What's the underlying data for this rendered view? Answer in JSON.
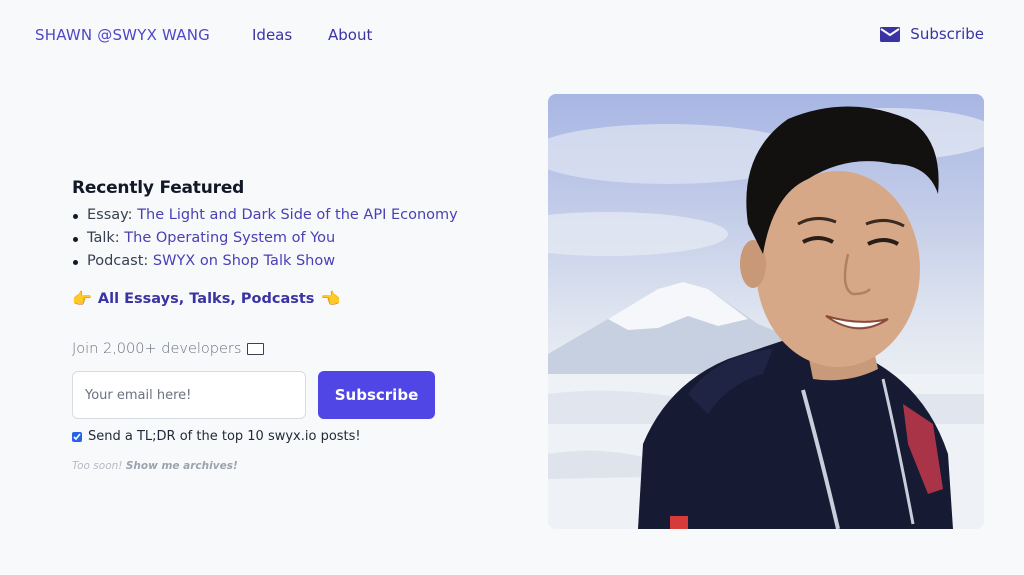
{
  "header": {
    "brand": "SHAWN @SWYX WANG",
    "nav": [
      {
        "label": "Ideas"
      },
      {
        "label": "About"
      }
    ],
    "subscribe": {
      "label": "Subscribe",
      "icon": "mail-icon"
    }
  },
  "featured": {
    "title": "Recently Featured",
    "items": [
      {
        "prefix": "Essay:",
        "link": "The Light and Dark Side of the API Economy"
      },
      {
        "prefix": "Talk:",
        "link": "The Operating System of You"
      },
      {
        "prefix": "Podcast:",
        "link": "SWYX on Shop Talk Show"
      }
    ],
    "all_link": {
      "label": "All Essays, Talks, Podcasts",
      "left_icon": "👉",
      "right_icon": "👈"
    }
  },
  "newsletter": {
    "join_text": "Join 2,000+ developers",
    "join_icon": "envelope-icon",
    "email_placeholder": "Your email here!",
    "email_value": "",
    "button_label": "Subscribe",
    "checkbox_label": "Send a TL;DR of the top 10 swyx.io posts!",
    "checkbox_checked": true,
    "archives_prefix": "Too soon!",
    "archives_link": "Show me archives!"
  },
  "photo": {
    "alt": "Portrait of Shawn Wang in front of a snowy mountain"
  },
  "colors": {
    "accent": "#4f46e5",
    "link": "#4a3fb5",
    "nav": "#3b33a3",
    "background": "#f8f9fb"
  }
}
